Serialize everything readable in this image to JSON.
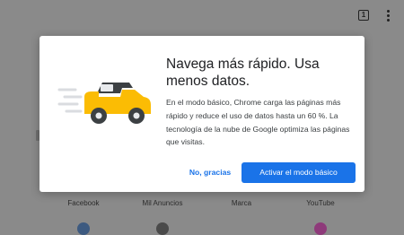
{
  "toolbar": {
    "tab_count": "1",
    "menu_icon": "more-vert-icon"
  },
  "dialog": {
    "title": "Navega más rápido. Usa menos datos.",
    "body": "En el modo básico, Chrome carga las páginas más rápido y reduce el uso de datos hasta un 60 %. La tecnología de la nube de Google optimiza las páginas que visitas.",
    "secondary_button": "No, gracias",
    "primary_button": "Activar el modo básico",
    "illustration_icon": "fast-car-icon"
  },
  "shortcuts": [
    {
      "label": "Facebook"
    },
    {
      "label": "Mil Anuncios"
    },
    {
      "label": "Marca"
    },
    {
      "label": "YouTube"
    }
  ],
  "colors": {
    "accent": "#1a73e8",
    "scrim": "#8a8a8a",
    "car_body": "#fbbc04",
    "car_window": "#3c4043"
  }
}
